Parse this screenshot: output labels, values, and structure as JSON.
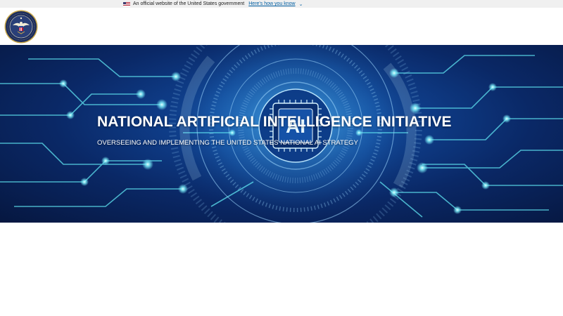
{
  "gov_banner": {
    "text": "An official website of the United States government",
    "link_text": "Here's how you know"
  },
  "header": {
    "logo_icon": "presidential-seal-icon"
  },
  "hero": {
    "title": "NATIONAL ARTIFICIAL INTELLIGENCE INITIATIVE",
    "subtitle": "OVERSEEING AND IMPLEMENTING THE UNITED STATES NATIONAL AI STRATEGY",
    "chip_label": "AI",
    "background_icon": "circuit-chip-icon"
  },
  "colors": {
    "banner_bg": "#f0f0f0",
    "link": "#005ea2",
    "hero_dark": "#061740",
    "hero_mid": "#0f3f8c",
    "glow": "#7ff5ff"
  }
}
